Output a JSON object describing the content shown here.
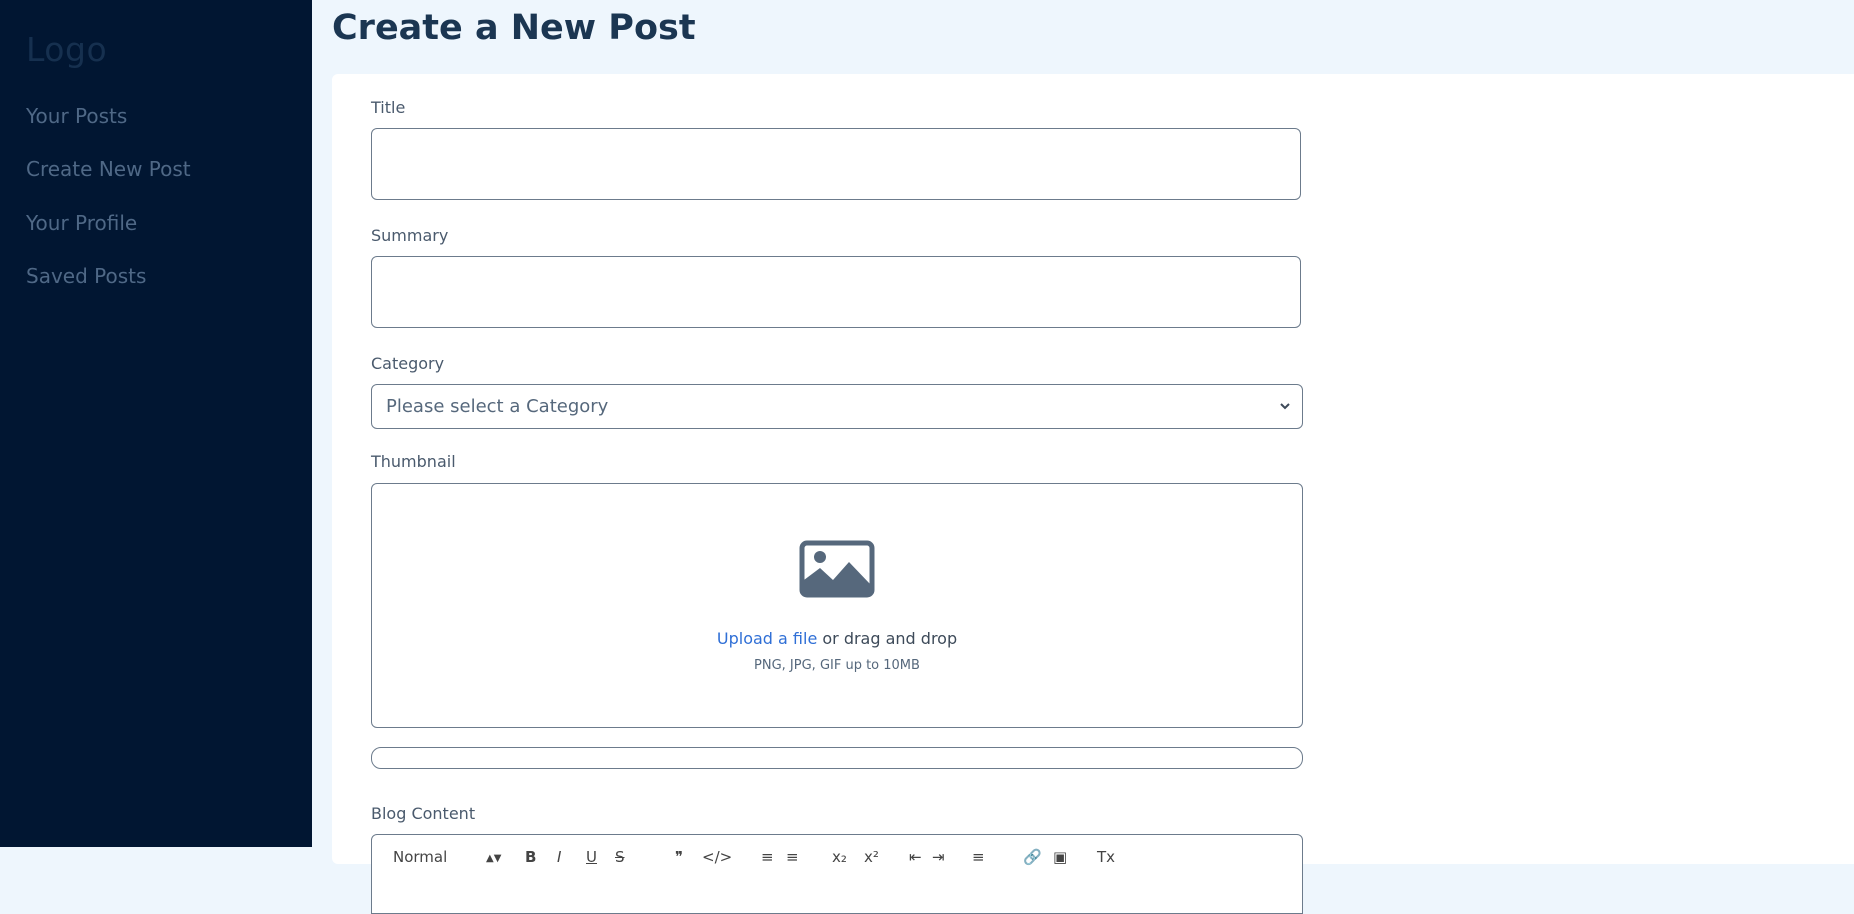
{
  "sidebar": {
    "logo": "Logo",
    "items": [
      {
        "label": "Your Posts"
      },
      {
        "label": "Create New Post"
      },
      {
        "label": "Your Profile"
      },
      {
        "label": "Saved Posts"
      }
    ]
  },
  "page": {
    "title": "Create a New Post"
  },
  "form": {
    "title_label": "Title",
    "title_value": "",
    "summary_label": "Summary",
    "summary_value": "",
    "category_label": "Category",
    "category_value": "Please select a Category",
    "thumbnail_label": "Thumbnail",
    "upload_link": "Upload a file",
    "upload_rest": " or drag and drop",
    "upload_hint": "PNG, JPG, GIF up to 10MB",
    "upload_progress_percent": 0,
    "content_label": "Blog Content"
  },
  "editor_toolbar": {
    "heading_value": "Normal",
    "buttons": [
      {
        "name": "bold",
        "glyph": "B"
      },
      {
        "name": "italic",
        "glyph": "I"
      },
      {
        "name": "underline",
        "glyph": "U"
      },
      {
        "name": "strike",
        "glyph": "S"
      },
      {
        "name": "blockquote",
        "glyph": "❞"
      },
      {
        "name": "code-block",
        "glyph": "</>"
      },
      {
        "name": "ordered-list",
        "glyph": "≡"
      },
      {
        "name": "bullet-list",
        "glyph": "≡"
      },
      {
        "name": "subscript",
        "glyph": "x₂"
      },
      {
        "name": "superscript",
        "glyph": "x²"
      },
      {
        "name": "outdent",
        "glyph": "⇤"
      },
      {
        "name": "indent",
        "glyph": "⇥"
      },
      {
        "name": "align",
        "glyph": "≡"
      },
      {
        "name": "link",
        "glyph": "🔗"
      },
      {
        "name": "image",
        "glyph": "▣"
      },
      {
        "name": "clean",
        "glyph": "Tx"
      }
    ]
  },
  "colors": {
    "sidebar_bg": "#011632",
    "page_bg": "#eef6fd",
    "title_color": "#1b3652",
    "link_blue": "#2f6fd6",
    "icon_gray": "#56687c"
  }
}
